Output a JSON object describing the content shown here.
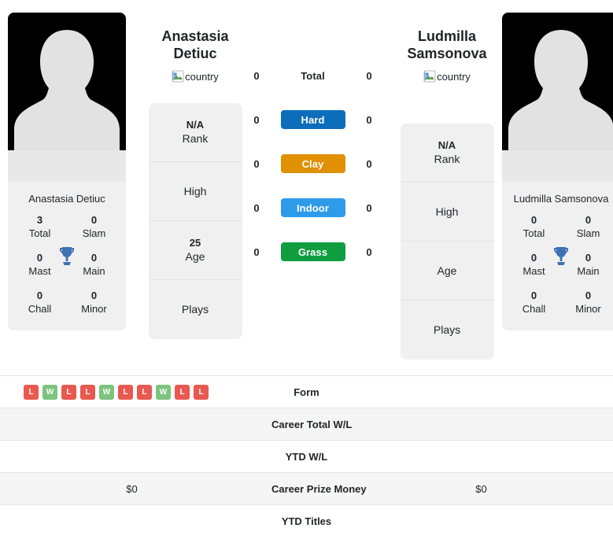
{
  "colors": {
    "hard": "#0c6dbb",
    "clay": "#e09000",
    "indoor": "#2e9bea",
    "grass": "#0f9d40",
    "win": "#7cc47f",
    "loss": "#e8594f",
    "trophy": "#3f72b5",
    "card_bg": "#f0f0f0"
  },
  "players": {
    "left": {
      "full_name_line1": "Anastasia",
      "full_name_line2": "Detiuc",
      "country_alt": "country",
      "card_name": "Anastasia Detiuc",
      "stats": [
        {
          "value": "3",
          "label": "Total"
        },
        {
          "value": "0",
          "label": "Slam"
        },
        {
          "value": "0",
          "label": "Mast"
        },
        {
          "value": "0",
          "label": "Main"
        },
        {
          "value": "0",
          "label": "Chall"
        },
        {
          "value": "0",
          "label": "Minor"
        }
      ],
      "info": [
        {
          "value": "N/A",
          "label": "Rank"
        },
        {
          "value": "",
          "label": "High"
        },
        {
          "value": "25",
          "label": "Age"
        },
        {
          "value": "",
          "label": "Plays"
        }
      ]
    },
    "right": {
      "full_name_line1": "Ludmilla",
      "full_name_line2": "Samsonova",
      "country_alt": "country",
      "card_name": "Ludmilla Samsonova",
      "stats": [
        {
          "value": "0",
          "label": "Total"
        },
        {
          "value": "0",
          "label": "Slam"
        },
        {
          "value": "0",
          "label": "Mast"
        },
        {
          "value": "0",
          "label": "Main"
        },
        {
          "value": "0",
          "label": "Chall"
        },
        {
          "value": "0",
          "label": "Minor"
        }
      ],
      "info": [
        {
          "value": "N/A",
          "label": "Rank"
        },
        {
          "value": "",
          "label": "High"
        },
        {
          "value": "",
          "label": "Age"
        },
        {
          "value": "",
          "label": "Plays"
        }
      ]
    }
  },
  "surfaces": [
    {
      "label": "Total",
      "left": "0",
      "right": "0",
      "badge": false,
      "color": ""
    },
    {
      "label": "Hard",
      "left": "0",
      "right": "0",
      "badge": true,
      "color": "#0c6dbb"
    },
    {
      "label": "Clay",
      "left": "0",
      "right": "0",
      "badge": true,
      "color": "#e09000"
    },
    {
      "label": "Indoor",
      "left": "0",
      "right": "0",
      "badge": true,
      "color": "#2e9bea"
    },
    {
      "label": "Grass",
      "left": "0",
      "right": "0",
      "badge": true,
      "color": "#0f9d40"
    }
  ],
  "comparison_rows": [
    {
      "label": "Form",
      "left": "",
      "right": "",
      "type": "form"
    },
    {
      "label": "Career Total W/L",
      "left": "",
      "right": "",
      "type": "text"
    },
    {
      "label": "YTD W/L",
      "left": "",
      "right": "",
      "type": "text"
    },
    {
      "label": "Career Prize Money",
      "left": "$0",
      "right": "$0",
      "type": "text"
    },
    {
      "label": "YTD Titles",
      "left": "",
      "right": "",
      "type": "text"
    }
  ],
  "form": {
    "left": [
      "L",
      "W",
      "L",
      "L",
      "W",
      "L",
      "L",
      "W",
      "L",
      "L"
    ],
    "right": []
  }
}
